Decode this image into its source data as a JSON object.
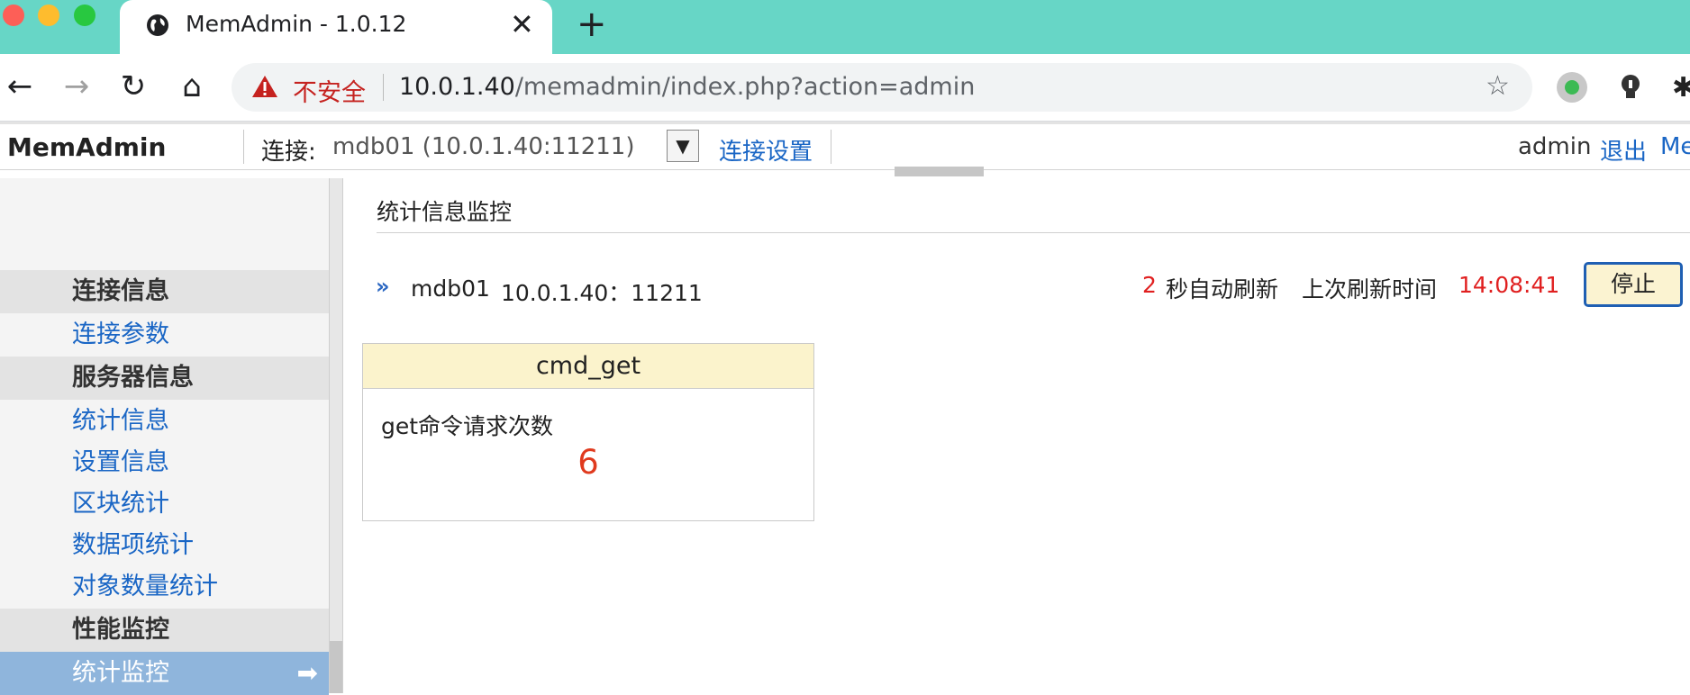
{
  "browser": {
    "tab_title": "MemAdmin - 1.0.12",
    "close_glyph": "✕",
    "new_tab_glyph": "+",
    "insecure_label": "不安全",
    "url_host": "10.0.1.40",
    "url_path": "/memadmin/index.php?action=admin",
    "icons": [
      "back-icon",
      "forward-icon",
      "reload-icon",
      "home-icon",
      "warning-icon",
      "star-icon",
      "extension-icon",
      "puzzle-icon"
    ]
  },
  "appbar": {
    "brand": "MemAdmin",
    "conn_label": "连接:",
    "conn_value": "mdb01 (10.0.1.40:11211)",
    "conn_settings": "连接设置",
    "user": "admin",
    "logout": "退出",
    "more_link": "Me"
  },
  "sidebar": {
    "groups": [
      {
        "head": "连接信息",
        "items": [
          "连接参数"
        ]
      },
      {
        "head": "服务器信息",
        "items": [
          "统计信息",
          "设置信息",
          "区块统计",
          "数据项统计",
          "对象数量统计"
        ]
      },
      {
        "head": "性能监控",
        "items": [
          "统计监控"
        ]
      }
    ],
    "active_item": "统计监控",
    "active_arrow": "➡"
  },
  "main": {
    "title": "统计信息监控",
    "server_name": "mdb01",
    "server_addr": "10.0.1.40：11211",
    "refresh_seconds": "2",
    "refresh_label": "秒自动刷新",
    "last_refresh_label": "上次刷新时间",
    "last_refresh_time": "14:08:41",
    "stop_button": "停止",
    "card": {
      "name": "cmd_get",
      "desc": "get命令请求次数",
      "value": "6"
    }
  },
  "colors": {
    "tabstrip": "#67d6c6",
    "link": "#1a66c5",
    "highlight_red": "#e02020",
    "card_head": "#fbf3cc",
    "active_item": "#8fb5dc"
  }
}
